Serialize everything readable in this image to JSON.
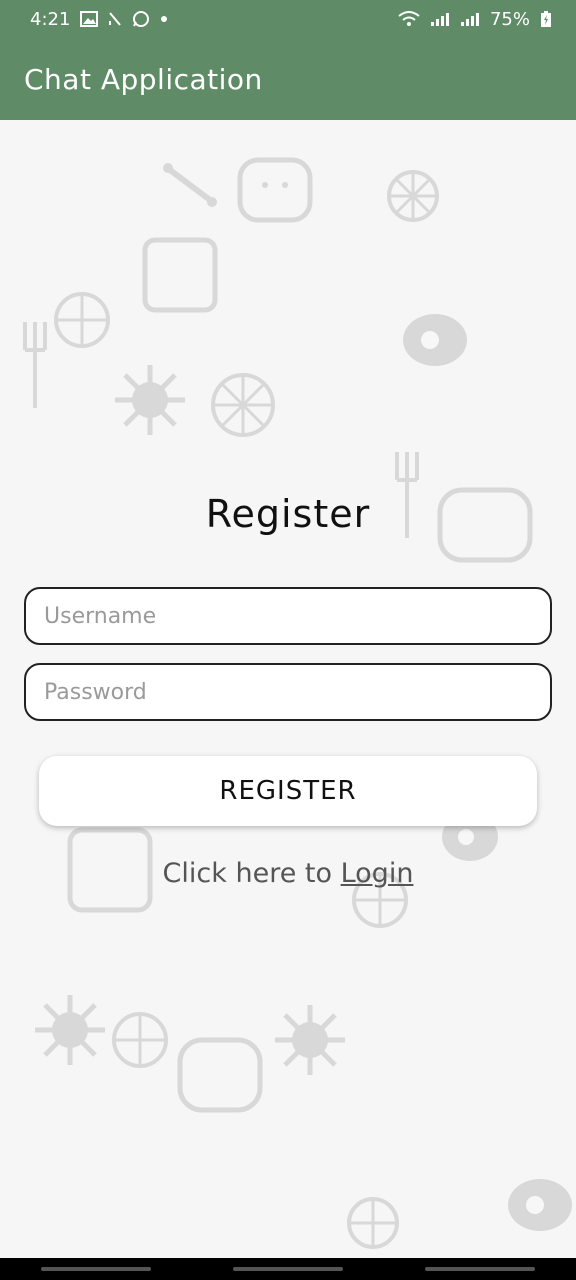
{
  "status_bar": {
    "time": "4:21",
    "battery": "75%",
    "icons": [
      "image-icon",
      "signal-slash-icon",
      "whatsapp-icon",
      "dot-icon",
      "wifi-icon",
      "signal-icon",
      "signal-icon",
      "battery-charging-icon"
    ]
  },
  "app_bar": {
    "title": "Chat Application"
  },
  "form": {
    "title": "Register",
    "username_placeholder": "Username",
    "password_placeholder": "Password",
    "register_button": "REGISTER",
    "login_prefix": "Click here to",
    "login_link": "Login"
  },
  "colors": {
    "accent": "#5f8b67",
    "background": "#f6f6f6"
  }
}
